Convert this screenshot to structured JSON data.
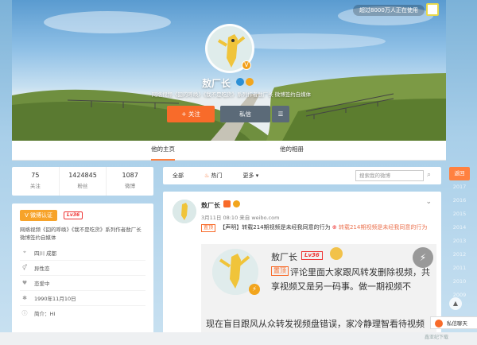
{
  "top_badge": "超过8000万人正在使用",
  "profile": {
    "name": "敖厂长",
    "description": "网络视频《囧的呼唤》《我不是吃货》系列作者敖厂长 微博签约自媒体",
    "follow_label": "+ 关注",
    "message_label": "私信",
    "more_icon": "menu-icon"
  },
  "nav": {
    "tabs": [
      "他的主页",
      "他的相册"
    ]
  },
  "stats": [
    {
      "value": "75",
      "label": "关注"
    },
    {
      "value": "1424845",
      "label": "粉丝"
    },
    {
      "value": "1087",
      "label": "微博"
    }
  ],
  "info": {
    "verify_label": "微博认证",
    "level": "Lv36",
    "verify_text": "网络视频《囧的呼唤》《我不是吃货》系列作者敖厂长 微博签约自媒体",
    "rows": [
      {
        "icon": "location-icon",
        "text": "四川 成都"
      },
      {
        "icon": "gender-icon",
        "text": "异性恋"
      },
      {
        "icon": "heart-icon",
        "text": "恋爱中"
      },
      {
        "icon": "birthday-icon",
        "text": "1990年11月10日"
      },
      {
        "icon": "intro-icon",
        "text": "简介：HI"
      }
    ]
  },
  "filter": {
    "all": "全部",
    "hot": "热门",
    "more": "更多",
    "search_placeholder": "搜索我的微博"
  },
  "post": {
    "name": "敖厂长",
    "time": "3月11日 08:10 来自 weibo.com",
    "tag": "置顶",
    "text_declare": "【声明】转载214期视频是未经我同意的行为",
    "text_repost": "转载214期视频是未经我同意的行为",
    "media": {
      "name": "敖厂长",
      "level": "Lv36",
      "tag": "置顶",
      "text": "评论里面大家跟风转发删除视频，共享视频又是另一码事。做一期视频不",
      "bottom": "现在盲目跟风从众转发视频盘错误，家冷静理智看待视频删除，如果在网害我对视频创作的积极性了"
    }
  },
  "timeline": [
    "返回",
    "2017",
    "2016",
    "2015",
    "2014",
    "2013",
    "2012",
    "2011",
    "2010",
    "2009"
  ],
  "privmsg": "私信聊天",
  "watermark": "鑫亚纪下载"
}
